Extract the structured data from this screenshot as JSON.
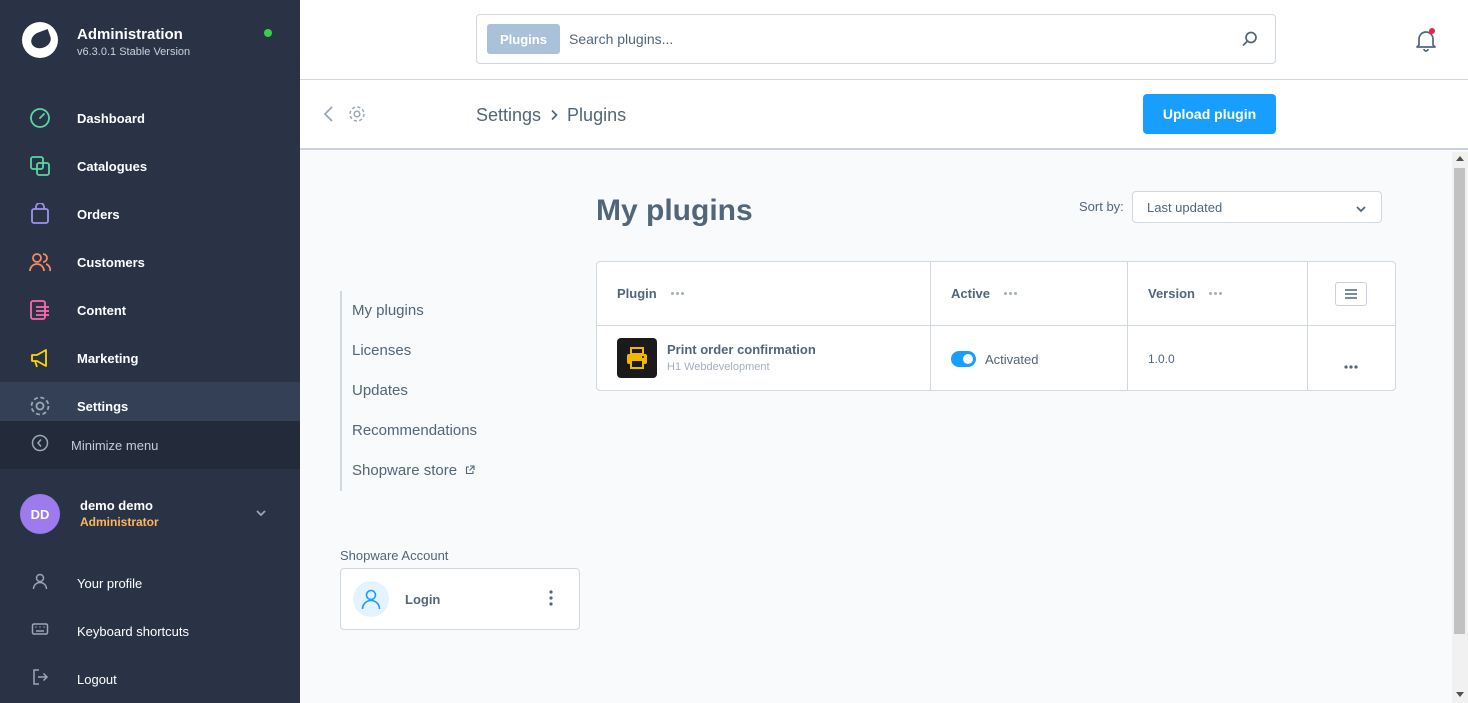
{
  "brand": {
    "title": "Administration",
    "version": "v6.3.0.1 Stable Version"
  },
  "nav": [
    {
      "label": "Dashboard",
      "icon": "dashboard-icon",
      "color": "#57d9a3"
    },
    {
      "label": "Catalogues",
      "icon": "catalogue-icon",
      "color": "#57d9a3"
    },
    {
      "label": "Orders",
      "icon": "orders-icon",
      "color": "#a092f0"
    },
    {
      "label": "Customers",
      "icon": "customers-icon",
      "color": "#f88962"
    },
    {
      "label": "Content",
      "icon": "content-icon",
      "color": "#ff68b4"
    },
    {
      "label": "Marketing",
      "icon": "marketing-icon",
      "color": "#ffd700"
    },
    {
      "label": "Settings",
      "icon": "settings-icon",
      "color": "#9aa8b5"
    }
  ],
  "minimize_label": "Minimize menu",
  "user": {
    "initials": "DD",
    "name": "demo demo",
    "role": "Administrator"
  },
  "footer": [
    {
      "label": "Your profile",
      "icon": "profile-icon"
    },
    {
      "label": "Keyboard shortcuts",
      "icon": "keyboard-icon"
    },
    {
      "label": "Logout",
      "icon": "logout-icon"
    }
  ],
  "search": {
    "tag": "Plugins",
    "placeholder": "Search plugins..."
  },
  "breadcrumb": {
    "parent": "Settings",
    "current": "Plugins"
  },
  "upload_label": "Upload plugin",
  "side_nav": [
    "My plugins",
    "Licenses",
    "Updates",
    "Recommendations",
    "Shopware store"
  ],
  "account": {
    "label": "Shopware Account",
    "login": "Login"
  },
  "page_title": "My plugins",
  "sort": {
    "label": "Sort by:",
    "value": "Last updated"
  },
  "grid": {
    "columns": [
      "Plugin",
      "Active",
      "Version"
    ],
    "rows": [
      {
        "name": "Print order confirmation",
        "vendor": "H1 Webdevelopment",
        "active": "Activated",
        "version": "1.0.0"
      }
    ]
  },
  "colors": {
    "accent": "#189eff",
    "sidebar": "#2a3345",
    "role": "#ffb75d",
    "status": "#37d046"
  }
}
